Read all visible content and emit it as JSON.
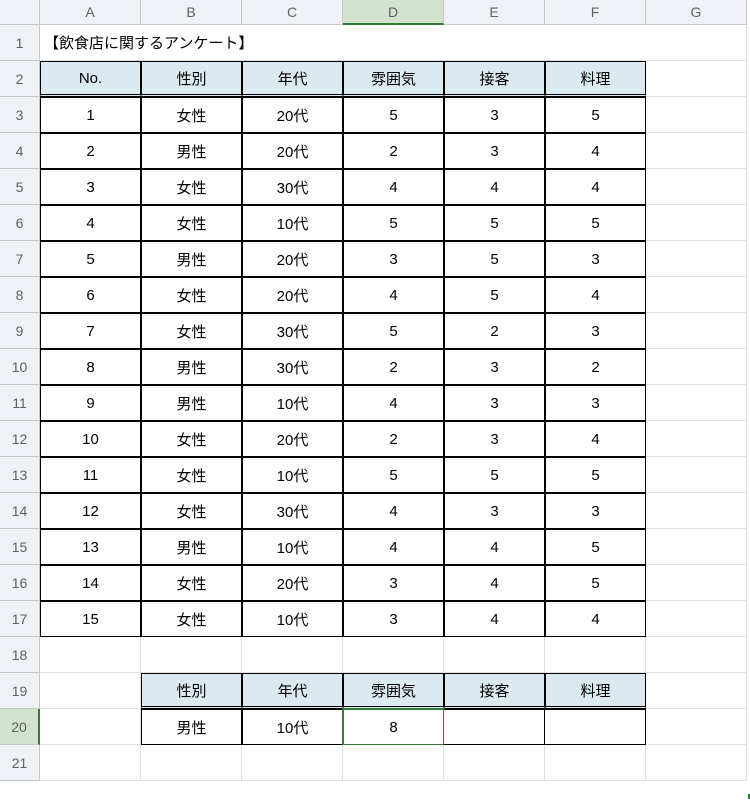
{
  "columns": [
    "A",
    "B",
    "C",
    "D",
    "E",
    "F",
    "G"
  ],
  "rowCount": 21,
  "title": "【飲食店に関するアンケート】",
  "headers": [
    "No.",
    "性別",
    "年代",
    "雰囲気",
    "接客",
    "料理"
  ],
  "rows": [
    [
      "1",
      "女性",
      "20代",
      "5",
      "3",
      "5"
    ],
    [
      "2",
      "男性",
      "20代",
      "2",
      "3",
      "4"
    ],
    [
      "3",
      "女性",
      "30代",
      "4",
      "4",
      "4"
    ],
    [
      "4",
      "女性",
      "10代",
      "5",
      "5",
      "5"
    ],
    [
      "5",
      "男性",
      "20代",
      "3",
      "5",
      "3"
    ],
    [
      "6",
      "女性",
      "20代",
      "4",
      "5",
      "4"
    ],
    [
      "7",
      "女性",
      "30代",
      "5",
      "2",
      "3"
    ],
    [
      "8",
      "男性",
      "30代",
      "2",
      "3",
      "2"
    ],
    [
      "9",
      "男性",
      "10代",
      "4",
      "3",
      "3"
    ],
    [
      "10",
      "女性",
      "20代",
      "2",
      "3",
      "4"
    ],
    [
      "11",
      "女性",
      "10代",
      "5",
      "5",
      "5"
    ],
    [
      "12",
      "女性",
      "30代",
      "4",
      "3",
      "3"
    ],
    [
      "13",
      "男性",
      "10代",
      "4",
      "4",
      "5"
    ],
    [
      "14",
      "女性",
      "20代",
      "3",
      "4",
      "5"
    ],
    [
      "15",
      "女性",
      "10代",
      "3",
      "4",
      "4"
    ]
  ],
  "summaryHeaders": [
    "性別",
    "年代",
    "雰囲気",
    "接客",
    "料理"
  ],
  "summaryRow": [
    "男性",
    "10代",
    "8",
    "",
    ""
  ],
  "selectedCol": "D",
  "selectedRow": 20,
  "chart_data": {
    "type": "table",
    "title": "【飲食店に関するアンケート】",
    "columns": [
      "No.",
      "性別",
      "年代",
      "雰囲気",
      "接客",
      "料理"
    ],
    "rows": [
      [
        1,
        "女性",
        "20代",
        5,
        3,
        5
      ],
      [
        2,
        "男性",
        "20代",
        2,
        3,
        4
      ],
      [
        3,
        "女性",
        "30代",
        4,
        4,
        4
      ],
      [
        4,
        "女性",
        "10代",
        5,
        5,
        5
      ],
      [
        5,
        "男性",
        "20代",
        3,
        5,
        3
      ],
      [
        6,
        "女性",
        "20代",
        4,
        5,
        4
      ],
      [
        7,
        "女性",
        "30代",
        5,
        2,
        3
      ],
      [
        8,
        "男性",
        "30代",
        2,
        3,
        2
      ],
      [
        9,
        "男性",
        "10代",
        4,
        3,
        3
      ],
      [
        10,
        "女性",
        "20代",
        2,
        3,
        4
      ],
      [
        11,
        "女性",
        "10代",
        5,
        5,
        5
      ],
      [
        12,
        "女性",
        "30代",
        4,
        3,
        3
      ],
      [
        13,
        "男性",
        "10代",
        4,
        4,
        5
      ],
      [
        14,
        "女性",
        "20代",
        3,
        4,
        5
      ],
      [
        15,
        "女性",
        "10代",
        3,
        4,
        4
      ]
    ],
    "filter_summary": {
      "性別": "男性",
      "年代": "10代",
      "雰囲気": 8
    }
  }
}
